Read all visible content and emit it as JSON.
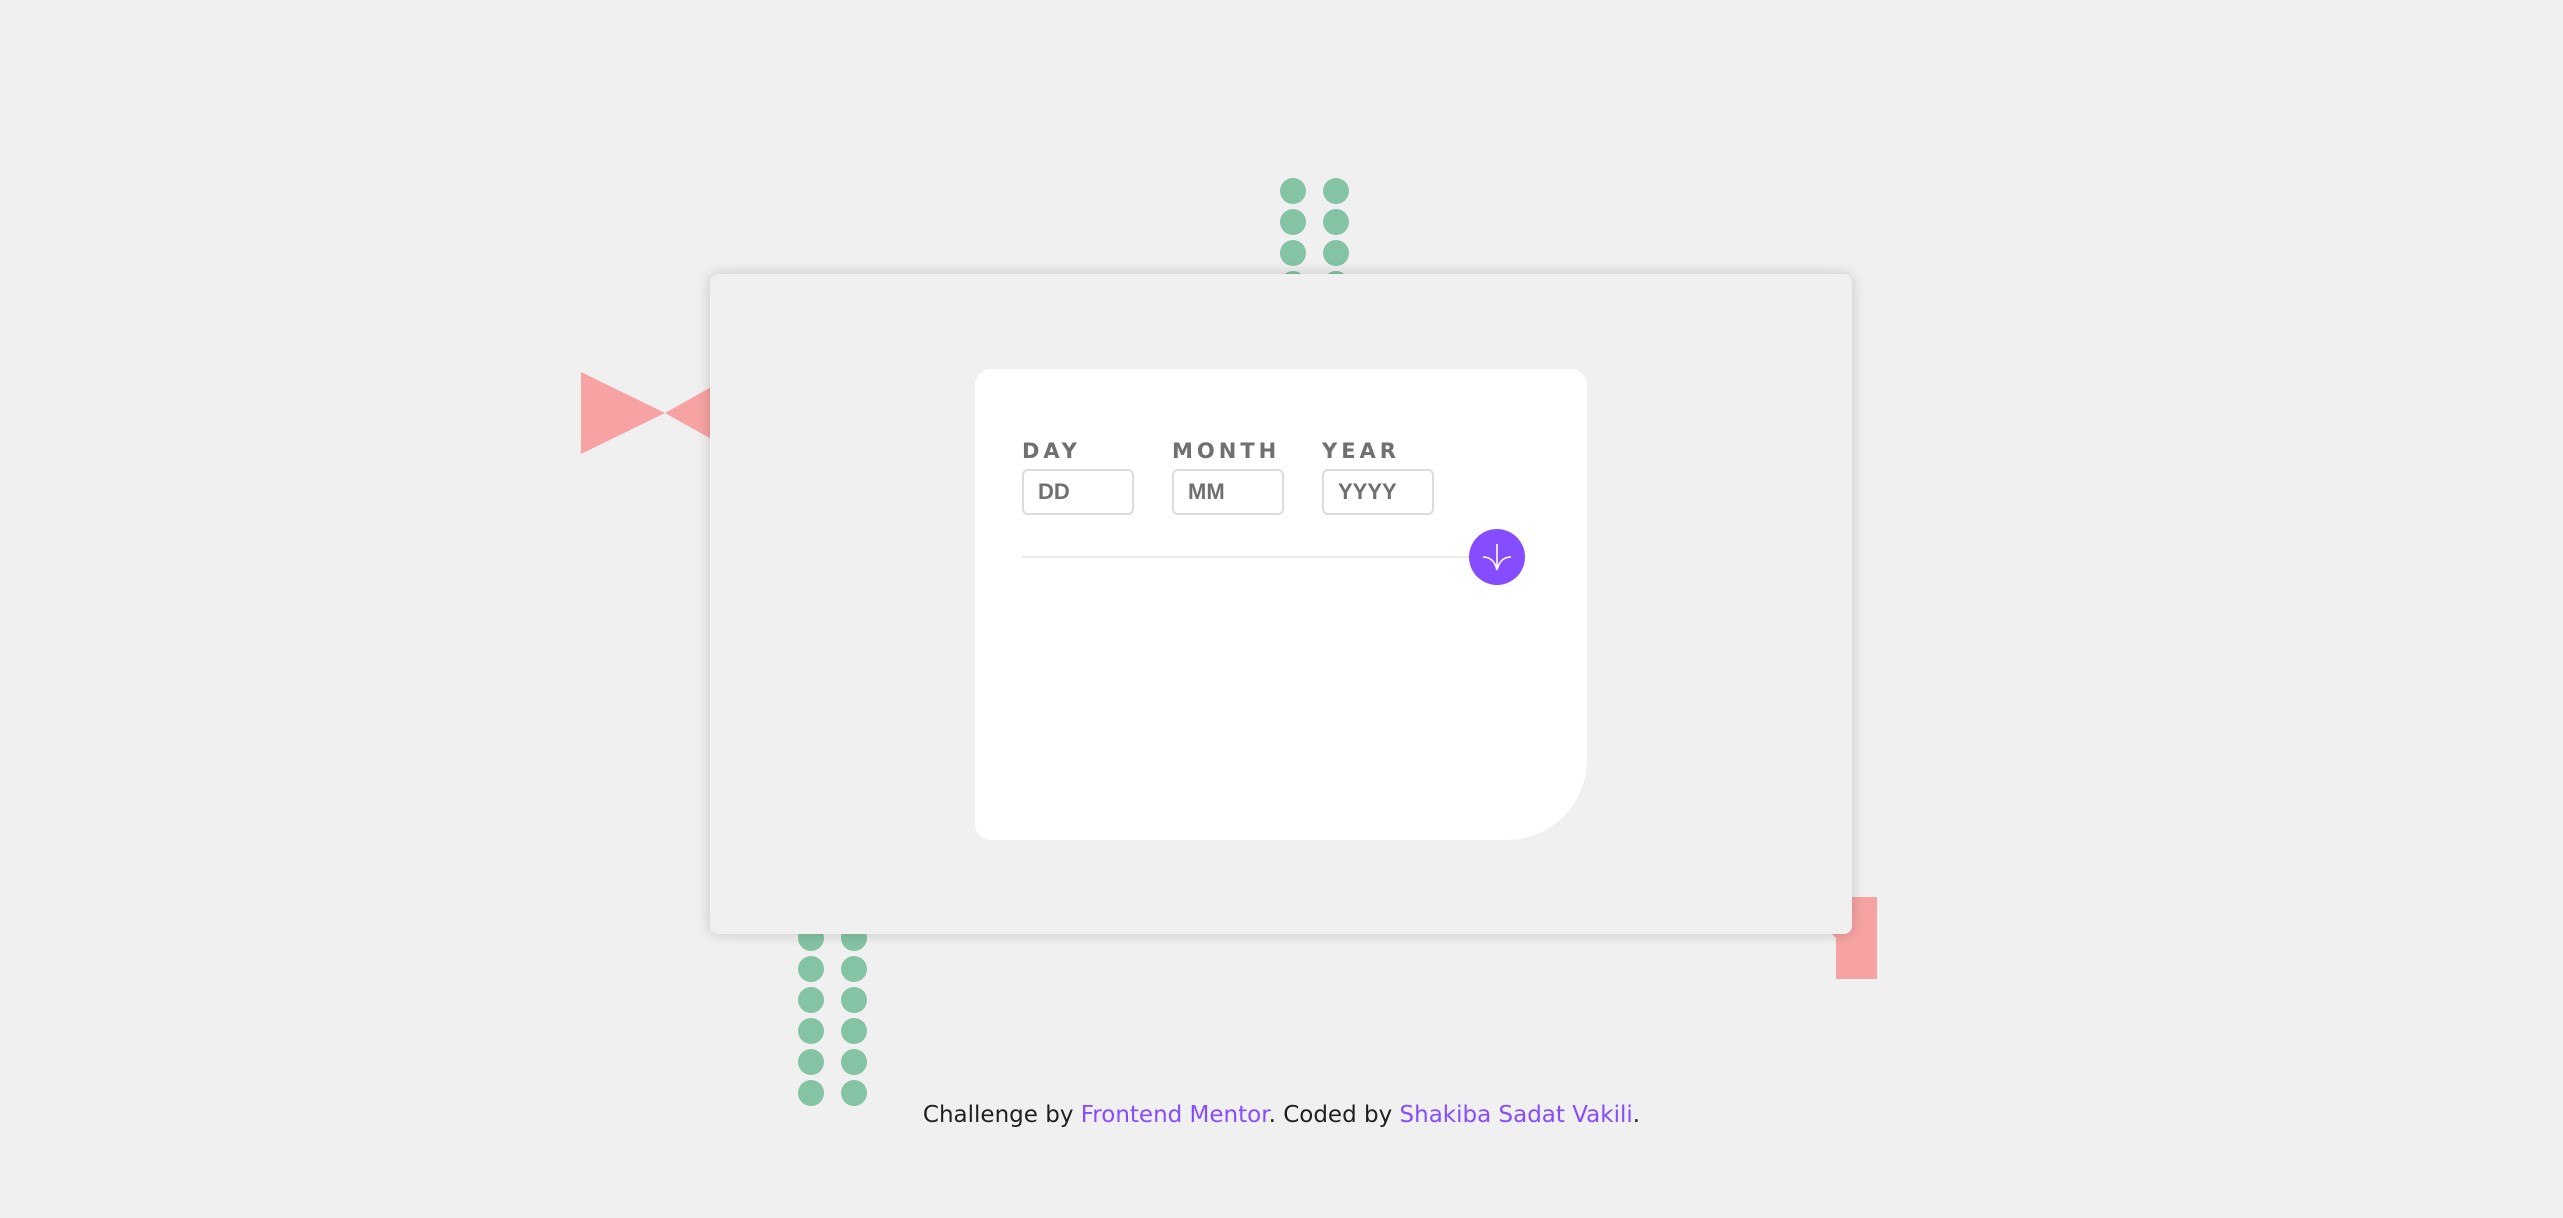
{
  "form": {
    "fields": [
      {
        "label": "DAY",
        "placeholder": "DD"
      },
      {
        "label": "MONTH",
        "placeholder": "MM"
      },
      {
        "label": "YEAR",
        "placeholder": "YYYY"
      }
    ],
    "submit_icon": "arrow-down-icon"
  },
  "footer": {
    "prefix": "Challenge by ",
    "link1": "Frontend Mentor",
    "middle": ". Coded by ",
    "link2": "Shakiba Sadat Vakili",
    "suffix": "."
  },
  "colors": {
    "accent": "#854dff",
    "dots": "#84c3a3",
    "triangles": "#f7a3a3",
    "background": "#f0f0f0",
    "label": "#716f6f"
  }
}
